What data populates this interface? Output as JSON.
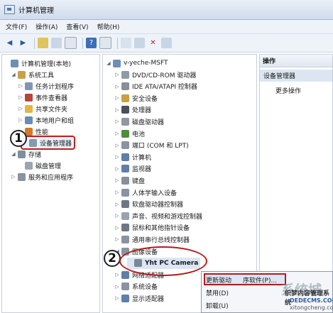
{
  "window": {
    "title": "计算机管理"
  },
  "menu": [
    "文件(F)",
    "操作(A)",
    "查看(V)",
    "帮助(H)"
  ],
  "left_tree": [
    {
      "label": "计算机管理(本地)",
      "level": 0,
      "exp": "",
      "icon": "computer-icon",
      "color": "#6d8fb8"
    },
    {
      "label": "系统工具",
      "level": 1,
      "exp": "◢",
      "icon": "tools-icon",
      "color": "#c8a04a"
    },
    {
      "label": "任务计划程序",
      "level": 2,
      "exp": "▷",
      "icon": "clock-icon",
      "color": "#7e96b3"
    },
    {
      "label": "事件查看器",
      "level": 2,
      "exp": "▷",
      "icon": "event-icon",
      "color": "#b5463a"
    },
    {
      "label": "共享文件夹",
      "level": 2,
      "exp": "▷",
      "icon": "shared-folder-icon",
      "color": "#e1b646"
    },
    {
      "label": "本地用户和组",
      "level": 2,
      "exp": "▷",
      "icon": "users-icon",
      "color": "#6c8bb4"
    },
    {
      "label": "性能",
      "level": 2,
      "exp": "▷",
      "icon": "performance-icon",
      "color": "#d07a2a"
    },
    {
      "label": "设备管理器",
      "level": 2,
      "exp": "",
      "icon": "device-manager-icon",
      "color": "#8b98a7"
    },
    {
      "label": "存储",
      "level": 1,
      "exp": "◢",
      "icon": "storage-icon",
      "color": "#7f8e9e"
    },
    {
      "label": "磁盘管理",
      "level": 2,
      "exp": "",
      "icon": "disk-icon",
      "color": "#9aa5b3"
    },
    {
      "label": "服务和应用程序",
      "level": 1,
      "exp": "▷",
      "icon": "services-icon",
      "color": "#8a93a0"
    }
  ],
  "center_root": "v-yeche-MSFT",
  "center_tree": [
    {
      "label": "DVD/CD-ROM 驱动器",
      "exp": "▷",
      "icon": "dvd-icon",
      "color": "#8f9aa8"
    },
    {
      "label": "IDE ATA/ATAPI 控制器",
      "exp": "▷",
      "icon": "ide-icon",
      "color": "#8a8f97"
    },
    {
      "label": "安全设备",
      "exp": "▷",
      "icon": "security-icon",
      "color": "#c9a040"
    },
    {
      "label": "处理器",
      "exp": "▷",
      "icon": "processor-icon",
      "color": "#4b4f57"
    },
    {
      "label": "磁盘驱动器",
      "exp": "▷",
      "icon": "disk-drive-icon",
      "color": "#8f97a1"
    },
    {
      "label": "电池",
      "exp": "▷",
      "icon": "battery-icon",
      "color": "#4f8c3c"
    },
    {
      "label": "端口 (COM 和 LPT)",
      "exp": "▷",
      "icon": "port-icon",
      "color": "#8a93a0"
    },
    {
      "label": "计算机",
      "exp": "▷",
      "icon": "computer-icon",
      "color": "#5f7ea8"
    },
    {
      "label": "监视器",
      "exp": "▷",
      "icon": "monitor-icon",
      "color": "#5f7ea8"
    },
    {
      "label": "键盘",
      "exp": "▷",
      "icon": "keyboard-icon",
      "color": "#8a8f97"
    },
    {
      "label": "人体学输入设备",
      "exp": "▷",
      "icon": "hid-icon",
      "color": "#8a93a0"
    },
    {
      "label": "软盘驱动器控制器",
      "exp": "▷",
      "icon": "floppy-controller-icon",
      "color": "#6d7784"
    },
    {
      "label": "声音、视频和游戏控制器",
      "exp": "▷",
      "icon": "sound-icon",
      "color": "#9aa3ad"
    },
    {
      "label": "鼠标和其他指针设备",
      "exp": "▷",
      "icon": "mouse-icon",
      "color": "#6d7784"
    },
    {
      "label": "通用串行总线控制器",
      "exp": "▷",
      "icon": "usb-icon",
      "color": "#8a93a0"
    },
    {
      "label": "图像设备",
      "exp": "◢",
      "icon": "imaging-icon",
      "color": "#8a93a0"
    },
    {
      "label": "Yht PC Camera",
      "exp": "",
      "icon": "camera-icon",
      "color": "#7c8796",
      "child": true
    },
    {
      "label": "网络适配器",
      "exp": "▷",
      "icon": "network-icon",
      "color": "#5f7ea8"
    },
    {
      "label": "系统设备",
      "exp": "▷",
      "icon": "system-device-icon",
      "color": "#8a93a0"
    },
    {
      "label": "显示适配器",
      "exp": "▷",
      "icon": "display-adapter-icon",
      "color": "#5f7ea8"
    }
  ],
  "actions": {
    "header": "操作",
    "selected": "设备管理器",
    "more": "更多操作"
  },
  "context_menu": [
    "更新驱动程序软件(P)...",
    "禁用(D)",
    "卸载(U)"
  ],
  "context_menu_visible": [
    "更新驱动",
    "序软件(P)..."
  ],
  "callouts": [
    "1",
    "2"
  ],
  "watermark": {
    "big": "系统城",
    "line1": "织梦内容管理系统",
    "line2": "DEDECMS.COM",
    "line3": "xitongcheng.com"
  }
}
